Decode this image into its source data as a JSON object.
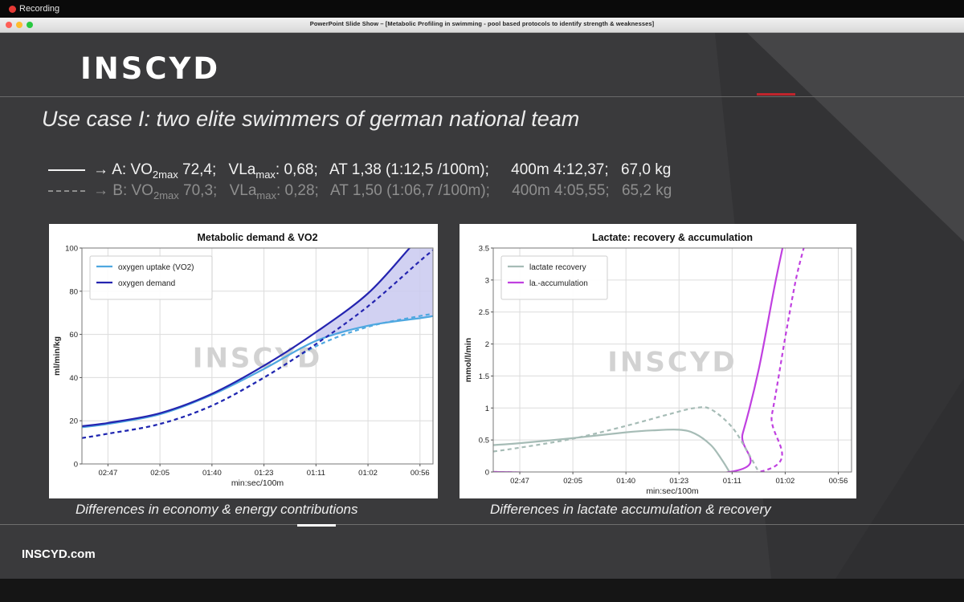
{
  "recording": {
    "label": "Recording"
  },
  "window": {
    "title": "PowerPoint Slide Show – [Metabolic Profiling in swimming - pool based protocols to identify strength & weaknesses]"
  },
  "slide": {
    "logo": "INSCYD",
    "title": "Use case I: two elite swimmers of german national team",
    "row_a": {
      "arrow": "→",
      "prefix": "A: VO",
      "vo2_sub": "2max",
      "vo2_val": " 72,4;",
      "vla": "VLa",
      "vla_sub": "max",
      "vla_val": ": 0,68;",
      "at": "AT 1,38 (1:12,5 /100m);",
      "m400": "400m 4:12,37;",
      "kg": "67,0 kg"
    },
    "row_b": {
      "arrow": "→",
      "prefix": "B: VO",
      "vo2_sub": "2max",
      "vo2_val": " 70,3;",
      "vla": "VLa",
      "vla_sub": "max",
      "vla_val": ": 0,28;",
      "at": "AT 1,50 (1:06,7 /100m);",
      "m400": "400m 4:05,55;",
      "kg": "65,2 kg"
    },
    "caption_left": "Differences in economy & energy contributions",
    "caption_right": "Differences in lactate accumulation & recovery",
    "footer": "INSCYD.com",
    "colors": {
      "background": "#3a3a3c",
      "accent": "#c0242c"
    }
  },
  "chart_data": [
    {
      "type": "line",
      "title": "Metabolic demand & VO2",
      "xlabel": "min:sec/100m",
      "ylabel": "ml/min/kg",
      "watermark": "INSCYD",
      "x_ticks": [
        "02:47",
        "02:05",
        "01:40",
        "01:23",
        "01:11",
        "01:02",
        "00:56"
      ],
      "x_tick_pos": [
        0,
        1,
        2,
        3,
        4,
        5,
        6
      ],
      "xlim": [
        -0.5,
        6.25
      ],
      "ylim": [
        0,
        100
      ],
      "y_ticks": [
        0,
        20,
        40,
        60,
        80,
        100
      ],
      "grid": true,
      "legend": "top-left",
      "shaded_between": [
        "oxygen demand",
        "oxygen uptake (VO2)"
      ],
      "shade_color": "#c9c9f0",
      "series": [
        {
          "name": "oxygen uptake (VO2)",
          "color": "#4fa8e0",
          "style": "solid",
          "x": [
            -0.5,
            0,
            1,
            2,
            3,
            4,
            5,
            6,
            6.25
          ],
          "y": [
            17,
            18.5,
            23,
            32,
            44,
            57,
            64,
            67.5,
            68.5
          ]
        },
        {
          "name": "oxygen demand",
          "color": "#2424b0",
          "style": "solid",
          "x": [
            -0.5,
            0,
            1,
            2,
            3,
            4,
            5,
            5.8,
            6.25
          ],
          "y": [
            17.5,
            19,
            23.5,
            32.5,
            45.5,
            61,
            79,
            100,
            112
          ]
        },
        {
          "name": "",
          "color": "#4fa8e0",
          "style": "dashed",
          "x": [
            -0.5,
            0,
            1,
            2,
            3,
            4,
            5,
            6,
            6.25
          ],
          "y": [
            12,
            14,
            18.5,
            27,
            40,
            54.5,
            63.5,
            68.5,
            69.5
          ]
        },
        {
          "name": "",
          "color": "#2424b0",
          "style": "dashed",
          "x": [
            -0.5,
            0,
            1,
            2,
            3,
            4,
            5,
            6,
            6.25
          ],
          "y": [
            12,
            14,
            18.5,
            27,
            40,
            55.5,
            73,
            94,
            99
          ]
        }
      ]
    },
    {
      "type": "line",
      "title": "Lactate: recovery & accumulation",
      "xlabel": "min:sec/100m",
      "ylabel": "mmol/l/min",
      "watermark": "INSCYD",
      "x_ticks": [
        "02:47",
        "02:05",
        "01:40",
        "01:23",
        "01:11",
        "01:02",
        "00:56"
      ],
      "x_tick_pos": [
        0,
        1,
        2,
        3,
        4,
        5,
        6
      ],
      "xlim": [
        -0.5,
        6.25
      ],
      "ylim": [
        0,
        3.5
      ],
      "y_ticks": [
        "0",
        "0.5",
        "1",
        "1.5",
        "2",
        "2.5",
        "3",
        "3.5"
      ],
      "grid": true,
      "legend": "top-left",
      "series": [
        {
          "name": "lactate recovery",
          "color": "#a6bcb6",
          "style": "solid",
          "x": [
            -0.5,
            0,
            1,
            2,
            2.5,
            3,
            3.3,
            3.6,
            3.8,
            3.95
          ],
          "y": [
            0.42,
            0.45,
            0.53,
            0.62,
            0.65,
            0.66,
            0.6,
            0.42,
            0.2,
            0
          ]
        },
        {
          "name": "la.-accumulation",
          "color": "#c040e0",
          "style": "solid",
          "x": [
            -0.5,
            3.95,
            4.2,
            4.5,
            4.8,
            4.95
          ],
          "y": [
            0,
            0,
            0.6,
            1.6,
            2.9,
            3.5
          ]
        },
        {
          "name": "",
          "color": "#a6bcb6",
          "style": "dashed",
          "x": [
            -0.5,
            0,
            1,
            2,
            2.8,
            3.3,
            3.6,
            4.0,
            4.3,
            4.5
          ],
          "y": [
            0.32,
            0.38,
            0.52,
            0.72,
            0.9,
            1.0,
            0.98,
            0.7,
            0.3,
            0
          ]
        },
        {
          "name": "",
          "color": "#c040e0",
          "style": "dashed",
          "x": [
            -0.5,
            4.5,
            4.75,
            5.0,
            5.2,
            5.35
          ],
          "y": [
            0,
            0,
            0.9,
            2.1,
            3.0,
            3.5
          ]
        }
      ]
    }
  ]
}
